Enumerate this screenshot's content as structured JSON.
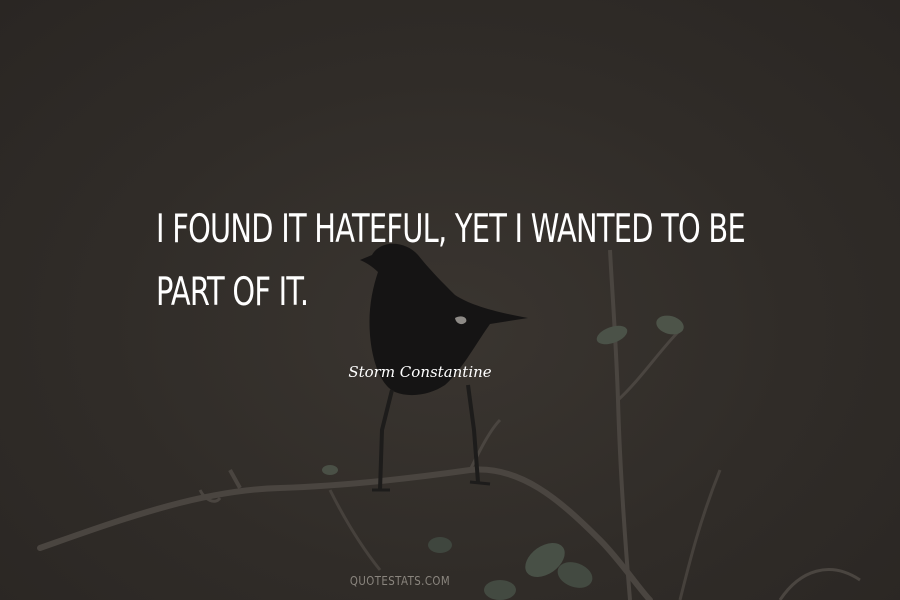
{
  "quote": {
    "text": "I found it hateful, yet I wanted to be part of it."
  },
  "author": {
    "name": "Storm Constantine"
  },
  "watermark": {
    "text": "QUOTESTATS.COM"
  },
  "colors": {
    "background": "#302c28",
    "text": "#ffffff",
    "watermark": "#8a857e"
  }
}
